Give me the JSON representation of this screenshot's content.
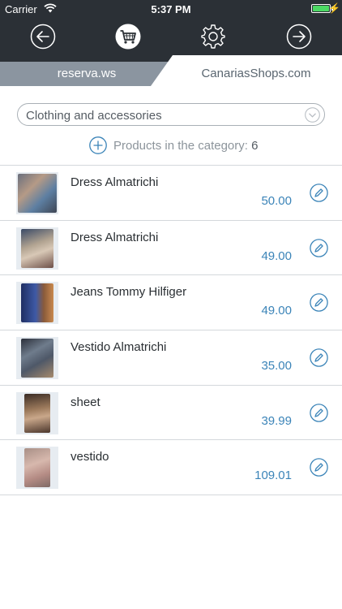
{
  "status_bar": {
    "carrier": "Carrier",
    "time": "5:37 PM"
  },
  "toolbar": {
    "back_icon": "arrow-left-circle-icon",
    "cart_icon": "shopping-cart-icon",
    "settings_icon": "gear-icon",
    "forward_icon": "arrow-right-circle-icon"
  },
  "tabs": [
    {
      "label": "reserva.ws",
      "active": false
    },
    {
      "label": "CanariasShops.com",
      "active": true
    }
  ],
  "category": {
    "selected": "Clothing and accessories"
  },
  "products_count": {
    "label": "Products in the category:",
    "value": "6"
  },
  "products": [
    {
      "name": "Dress Almatrichi",
      "price": "50.00"
    },
    {
      "name": "Dress Almatrichi",
      "price": "49.00"
    },
    {
      "name": "Jeans Tommy Hilfiger",
      "price": "49.00"
    },
    {
      "name": "Vestido Almatrichi",
      "price": "35.00"
    },
    {
      "name": "sheet",
      "price": "39.99"
    },
    {
      "name": "vestido",
      "price": "109.01"
    }
  ],
  "colors": {
    "bar": "#2b3036",
    "accent": "#3b84b8",
    "inactive_tab": "#8b95a0",
    "battery": "#4cd964"
  }
}
